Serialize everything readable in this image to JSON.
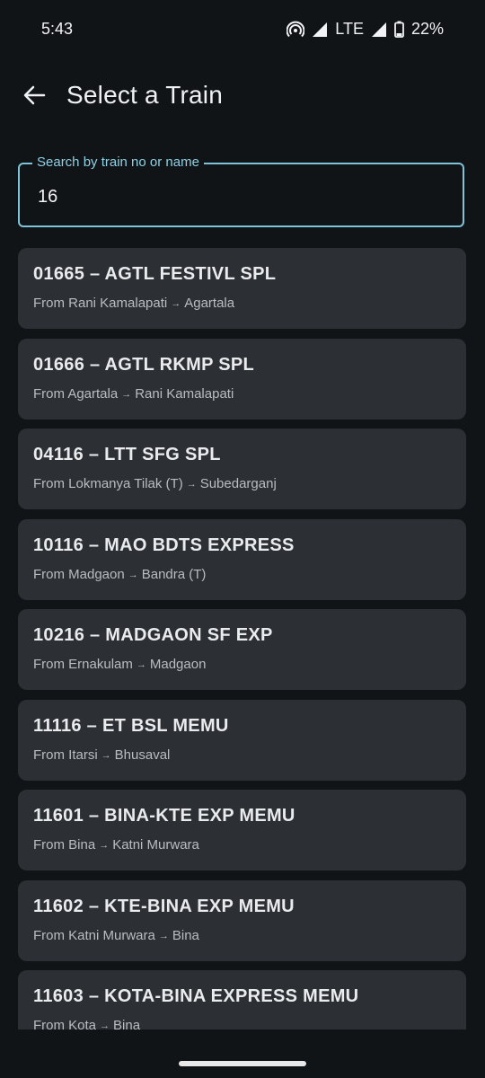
{
  "status": {
    "time": "5:43",
    "network": "LTE",
    "battery": "22%"
  },
  "header": {
    "title": "Select a Train",
    "back_icon": "arrow-left-icon"
  },
  "search": {
    "label": "Search by train no or name",
    "value": "16"
  },
  "trains": [
    {
      "name": "01665 – AGTL FESTIVL SPL",
      "route_prefix": "From Rani Kamalapati",
      "arrow": "→",
      "destination": "Agartala"
    },
    {
      "name": "01666 – AGTL RKMP SPL",
      "route_prefix": "From Agartala",
      "arrow": "→",
      "destination": "Rani Kamalapati"
    },
    {
      "name": "04116 – LTT SFG SPL",
      "route_prefix": "From Lokmanya Tilak (T)",
      "arrow": "→",
      "destination": "Subedarganj"
    },
    {
      "name": "10116 – MAO BDTS EXPRESS",
      "route_prefix": "From Madgaon",
      "arrow": "→",
      "destination": "Bandra (T)"
    },
    {
      "name": "10216 – MADGAON SF EXP",
      "route_prefix": "From Ernakulam",
      "arrow": "→",
      "destination": "Madgaon"
    },
    {
      "name": "11116 – ET BSL MEMU",
      "route_prefix": "From Itarsi",
      "arrow": "→",
      "destination": "Bhusaval"
    },
    {
      "name": "11601 – BINA-KTE EXP MEMU",
      "route_prefix": "From Bina",
      "arrow": "→",
      "destination": "Katni Murwara"
    },
    {
      "name": "11602 – KTE-BINA EXP MEMU",
      "route_prefix": "From Katni Murwara",
      "arrow": "→",
      "destination": "Bina"
    },
    {
      "name": "11603 – KOTA-BINA EXPRESS MEMU",
      "route_prefix": "From Kota",
      "arrow": "→",
      "destination": "Bina"
    }
  ]
}
